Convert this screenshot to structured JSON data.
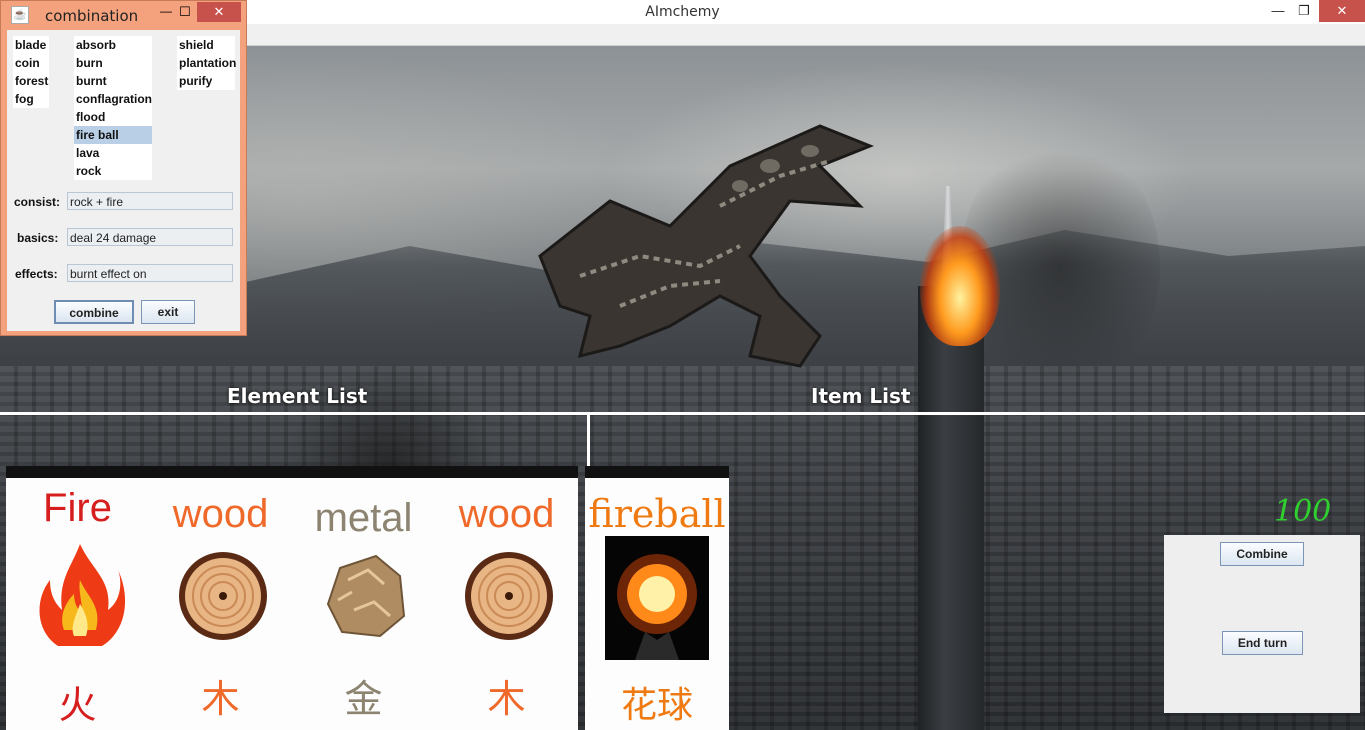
{
  "window": {
    "title": "AImchemy",
    "minimize": "—",
    "maximize": "❐",
    "close": "✕"
  },
  "scene": {
    "element_list_heading": "Element List",
    "item_list_heading": "Item List"
  },
  "element_cards": [
    {
      "name": "Fire",
      "glyph": "火",
      "color": "#d61e1e"
    },
    {
      "name": "wood",
      "glyph": "木",
      "color": "#ef6a2a"
    },
    {
      "name": "metal",
      "glyph": "金",
      "color": "#8c8370"
    },
    {
      "name": "wood",
      "glyph": "木",
      "color": "#ef6a2a"
    }
  ],
  "item_cards": [
    {
      "name": "fireball",
      "glyph": "花球",
      "color": "#f07a12"
    }
  ],
  "status": {
    "hp": "100"
  },
  "actions": {
    "combine_label": "Combine",
    "end_turn_label": "End turn"
  },
  "dialog": {
    "title": "combination",
    "java_icon": "☕",
    "minimize": "—",
    "maximize": "☐",
    "close": "✕",
    "list1": [
      "blade",
      "coin",
      "forest",
      "fog"
    ],
    "list2": [
      "absorb",
      "burn",
      "burnt",
      "conflagration",
      "flood",
      "fire ball",
      "lava",
      "rock"
    ],
    "list2_selected": "fire ball",
    "list3": [
      "shield",
      "plantation",
      "purify"
    ],
    "consist_label": "consist:",
    "consist_value": "rock + fire",
    "basics_label": "basics:",
    "basics_value": "deal 24 damage",
    "effects_label": "effects:",
    "effects_value": "burnt effect on",
    "combine_label": "combine",
    "exit_label": "exit"
  }
}
